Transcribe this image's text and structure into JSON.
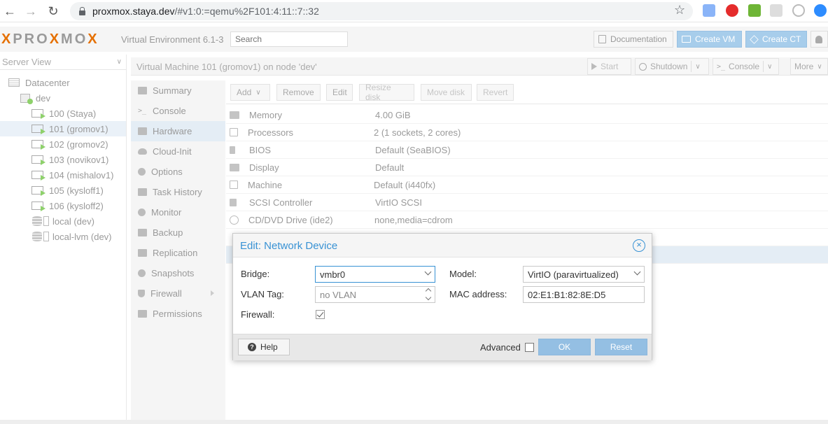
{
  "browser": {
    "url_host": "proxmox.staya.dev",
    "url_rest": "/#v1:0:=qemu%2F101:4:11::7::32"
  },
  "header": {
    "logo": "PROXMOX",
    "version": "Virtual Environment 6.1-3",
    "search_placeholder": "Search",
    "documentation": "Documentation",
    "create_vm": "Create VM",
    "create_ct": "Create CT"
  },
  "tree": {
    "view_label": "Server View",
    "datacenter": "Datacenter",
    "node": "dev",
    "vms": [
      {
        "label": "100 (Staya)"
      },
      {
        "label": "101 (gromov1)"
      },
      {
        "label": "102 (gromov2)"
      },
      {
        "label": "103 (novikov1)"
      },
      {
        "label": "104 (mishalov1)"
      },
      {
        "label": "105 (kysloff1)"
      },
      {
        "label": "106 (kysloff2)"
      }
    ],
    "storages": [
      {
        "label": "local (dev)"
      },
      {
        "label": "local-lvm (dev)"
      }
    ]
  },
  "vm_toolbar": {
    "title": "Virtual Machine 101 (gromov1) on node 'dev'",
    "start": "Start",
    "shutdown": "Shutdown",
    "console": "Console",
    "more": "More"
  },
  "nav": {
    "items": [
      {
        "label": "Summary",
        "icon": "book-icon"
      },
      {
        "label": "Console",
        "icon": "terminal-icon"
      },
      {
        "label": "Hardware",
        "icon": "monitor-icon"
      },
      {
        "label": "Cloud-Init",
        "icon": "cloud-icon"
      },
      {
        "label": "Options",
        "icon": "gear-icon"
      },
      {
        "label": "Task History",
        "icon": "list-icon"
      },
      {
        "label": "Monitor",
        "icon": "eye-icon"
      },
      {
        "label": "Backup",
        "icon": "floppy-icon"
      },
      {
        "label": "Replication",
        "icon": "retweet-icon"
      },
      {
        "label": "Snapshots",
        "icon": "history-icon"
      },
      {
        "label": "Firewall",
        "icon": "shield-icon"
      },
      {
        "label": "Permissions",
        "icon": "unlock-icon"
      }
    ]
  },
  "hw_toolbar": {
    "add": "Add",
    "remove": "Remove",
    "edit": "Edit",
    "resize_disk": "Resize disk",
    "move_disk": "Move disk",
    "revert": "Revert"
  },
  "hardware": {
    "rows": [
      {
        "name": "Memory",
        "value": "4.00 GiB"
      },
      {
        "name": "Processors",
        "value": "2 (1 sockets, 2 cores)"
      },
      {
        "name": "BIOS",
        "value": "Default (SeaBIOS)"
      },
      {
        "name": "Display",
        "value": "Default"
      },
      {
        "name": "Machine",
        "value": "Default (i440fx)"
      },
      {
        "name": "SCSI Controller",
        "value": "VirtIO SCSI"
      },
      {
        "name": "CD/DVD Drive (ide2)",
        "value": "none,media=cdrom"
      }
    ]
  },
  "dialog": {
    "title": "Edit: Network Device",
    "bridge_label": "Bridge:",
    "bridge_value": "vmbr0",
    "vlan_label": "VLAN Tag:",
    "vlan_placeholder": "no VLAN",
    "firewall_label": "Firewall:",
    "model_label": "Model:",
    "model_value": "VirtIO (paravirtualized)",
    "mac_label": "MAC address:",
    "mac_value": "02:E1:B1:82:8E:D5",
    "help": "Help",
    "advanced": "Advanced",
    "ok": "OK",
    "reset": "Reset"
  },
  "colors": {
    "accent": "#3892d4",
    "button_disabled_blue": "#94bfe3",
    "running_green": "#8ed16b",
    "brand_orange": "#e57000"
  }
}
